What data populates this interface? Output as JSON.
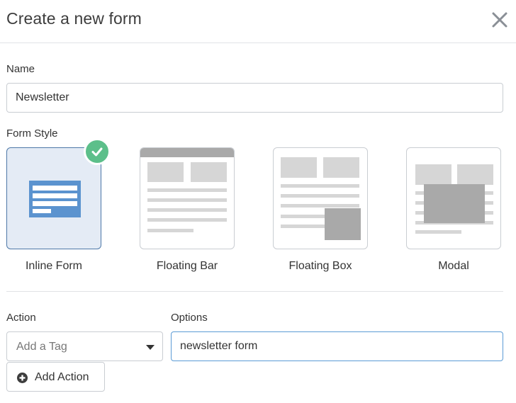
{
  "dialog": {
    "title": "Create a new form",
    "close_icon": "close-icon"
  },
  "name": {
    "label": "Name",
    "value": "Newsletter"
  },
  "form_style": {
    "label": "Form Style",
    "selected": "Inline Form",
    "options": [
      {
        "label": "Inline Form",
        "icon": "inline-form-icon"
      },
      {
        "label": "Floating Bar",
        "icon": "floating-bar-icon"
      },
      {
        "label": "Floating Box",
        "icon": "floating-box-icon"
      },
      {
        "label": "Modal",
        "icon": "modal-icon"
      }
    ]
  },
  "action": {
    "label": "Action",
    "selected_value": "Add a Tag",
    "add_button_label": "Add Action"
  },
  "options": {
    "label": "Options",
    "value": "newsletter form"
  },
  "colors": {
    "selected_card_bg": "#e4ebf5",
    "selected_card_border": "#4e78a8",
    "check_badge": "#5cbf8a",
    "inline_form_blue": "#5b93cf",
    "preview_gray": "#d6d6d6"
  }
}
